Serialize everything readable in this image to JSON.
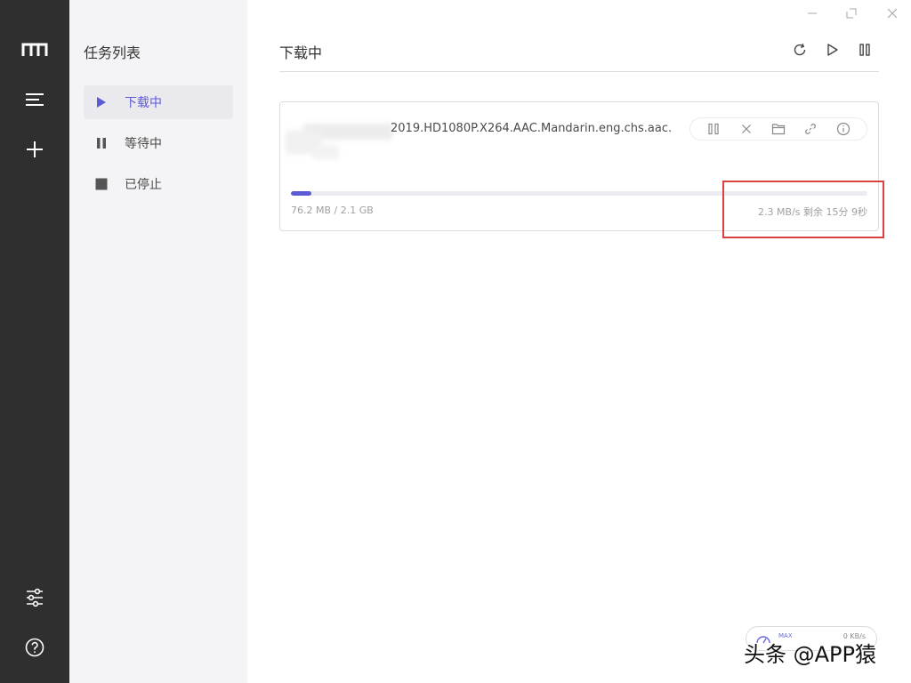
{
  "rail": {
    "items": [
      {
        "icon": "logo-icon"
      },
      {
        "icon": "menu-icon"
      },
      {
        "icon": "add-icon"
      },
      {
        "icon": "settings-sliders-icon"
      },
      {
        "icon": "help-icon"
      }
    ]
  },
  "tasklist": {
    "title": "任务列表",
    "items": [
      {
        "label": "下载中",
        "icon": "play-icon",
        "active": true
      },
      {
        "label": "等待中",
        "icon": "pause-icon",
        "active": false
      },
      {
        "label": "已停止",
        "icon": "stop-icon",
        "active": false
      }
    ]
  },
  "main": {
    "title": "下载中",
    "toolbar": {
      "refresh": "refresh-icon",
      "resume_all": "play-icon",
      "pause_all": "pause-icon"
    },
    "task": {
      "name": "2019.HD1080P.X264.AAC.Mandarin.eng.chs.aac.",
      "progress": 0.036,
      "size": "76.2 MB / 2.1 GB",
      "speed": "2.3 MB/s 剩余 15分 9秒",
      "actions": [
        "pause-icon",
        "delete-icon",
        "folder-icon",
        "link-icon",
        "info-icon"
      ]
    }
  },
  "speedometer": {
    "max_label": "MAX",
    "rate": "0 KB/s"
  },
  "watermark": "头条 @APP猿",
  "colors": {
    "accent": "#5b5bd6",
    "rail_bg": "#2f2f2f",
    "tasklist_bg": "#f4f4f6",
    "highlight": "#d9403f"
  }
}
